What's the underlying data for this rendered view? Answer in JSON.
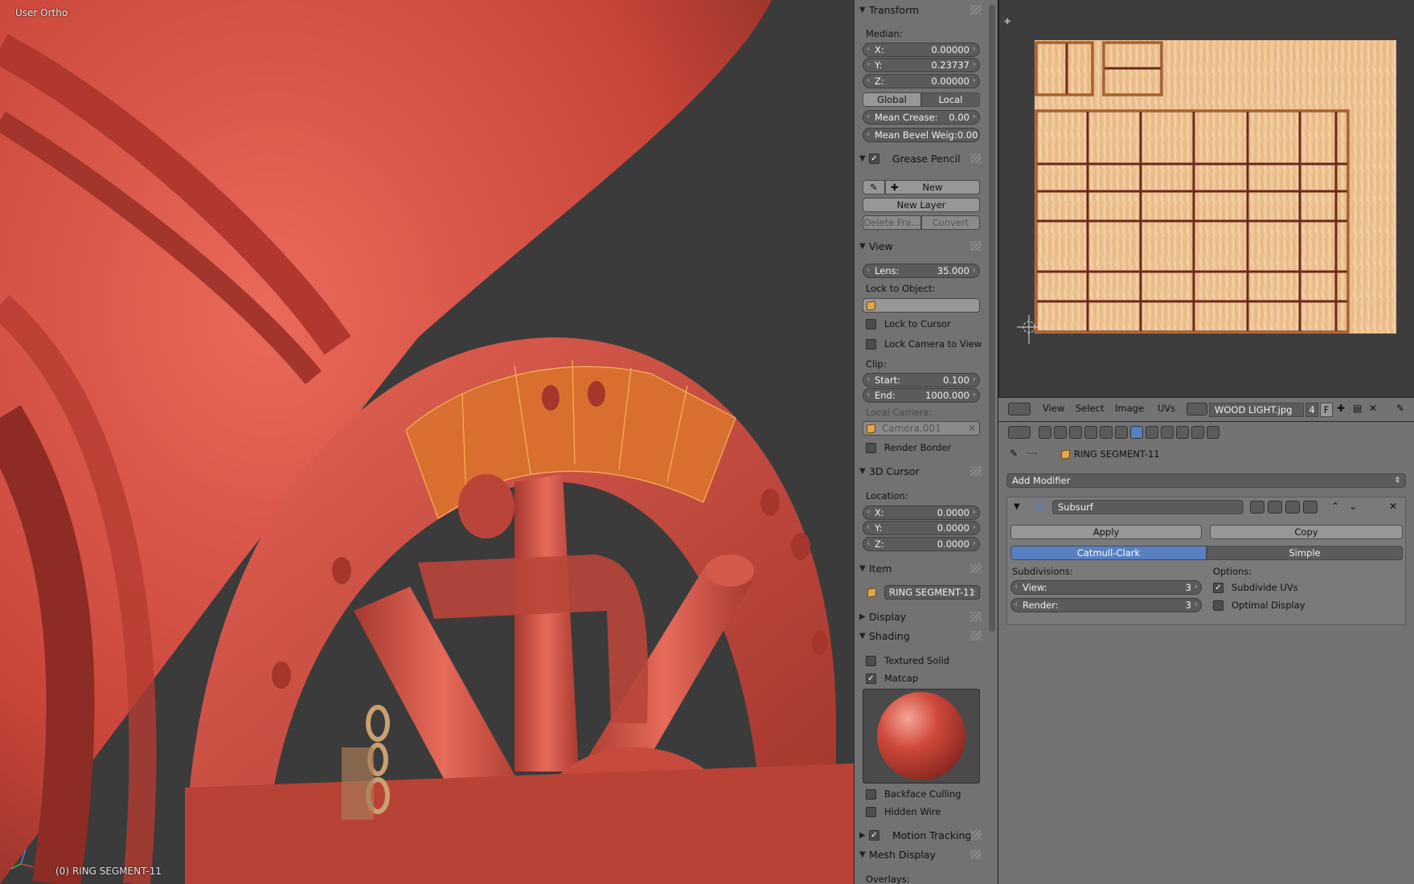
{
  "viewport": {
    "view_name": "User Ortho",
    "object_status": "(0) RING SEGMENT-11"
  },
  "npanel": {
    "transform": {
      "title": "Transform",
      "median_label": "Median:",
      "x_label": "X:",
      "x_value": "0.00000",
      "y_label": "Y:",
      "y_value": "0.23737",
      "z_label": "Z:",
      "z_value": "0.00000",
      "global_label": "Global",
      "local_label": "Local",
      "mean_crease_label": "Mean Crease:",
      "mean_crease_value": "0.00",
      "mean_bevel_label": "Mean Bevel Weig:",
      "mean_bevel_value": "0.00"
    },
    "grease_pencil": {
      "title": "Grease Pencil",
      "new_label": "New",
      "new_layer_label": "New Layer",
      "delete_frame_label": "Delete Fra...",
      "convert_label": "Convert"
    },
    "view": {
      "title": "View",
      "lens_label": "Lens:",
      "lens_value": "35.000",
      "lock_to_object_label": "Lock to Object:",
      "lock_to_cursor_label": "Lock to Cursor",
      "lock_camera_label": "Lock Camera to View",
      "clip_label": "Clip:",
      "start_label": "Start:",
      "start_value": "0.100",
      "end_label": "End:",
      "end_value": "1000.000",
      "local_camera_label": "Local Camera:",
      "camera_value": "Camera.001",
      "render_border_label": "Render Border"
    },
    "cursor": {
      "title": "3D Cursor",
      "location_label": "Location:",
      "x_label": "X:",
      "x_value": "0.0000",
      "y_label": "Y:",
      "y_value": "0.0000",
      "z_label": "Z:",
      "z_value": "0.0000"
    },
    "item": {
      "title": "Item",
      "name_value": "RING SEGMENT-11"
    },
    "display": {
      "title": "Display"
    },
    "shading": {
      "title": "Shading",
      "textured_solid_label": "Textured Solid",
      "matcap_label": "Matcap",
      "backface_culling_label": "Backface Culling",
      "hidden_wire_label": "Hidden Wire"
    },
    "motion_tracking": {
      "title": "Motion Tracking"
    },
    "mesh_display": {
      "title": "Mesh Display",
      "overlays_label": "Overlays:"
    }
  },
  "uv_header": {
    "view_menu": "View",
    "select_menu": "Select",
    "image_menu": "Image",
    "uvs_menu": "UVs",
    "image_name": "WOOD LIGHT.jpg",
    "users_count": "4",
    "fake_user": "F"
  },
  "modifier_panel": {
    "object_name": "RING SEGMENT-11",
    "add_modifier_label": "Add Modifier",
    "modifier_name": "Subsurf",
    "apply_label": "Apply",
    "copy_label": "Copy",
    "catmull_clark_label": "Catmull-Clark",
    "simple_label": "Simple",
    "subdivisions_label": "Subdivisions:",
    "view_label": "View:",
    "view_value": "3",
    "render_label": "Render:",
    "render_value": "3",
    "options_label": "Options:",
    "subdivide_uvs_label": "Subdivide UVs",
    "optimal_display_label": "Optimal Display"
  },
  "colors": {
    "selection_orange": "#e3a64a",
    "active_tab_blue": "#5680c2",
    "model_red": "#c8473b"
  }
}
